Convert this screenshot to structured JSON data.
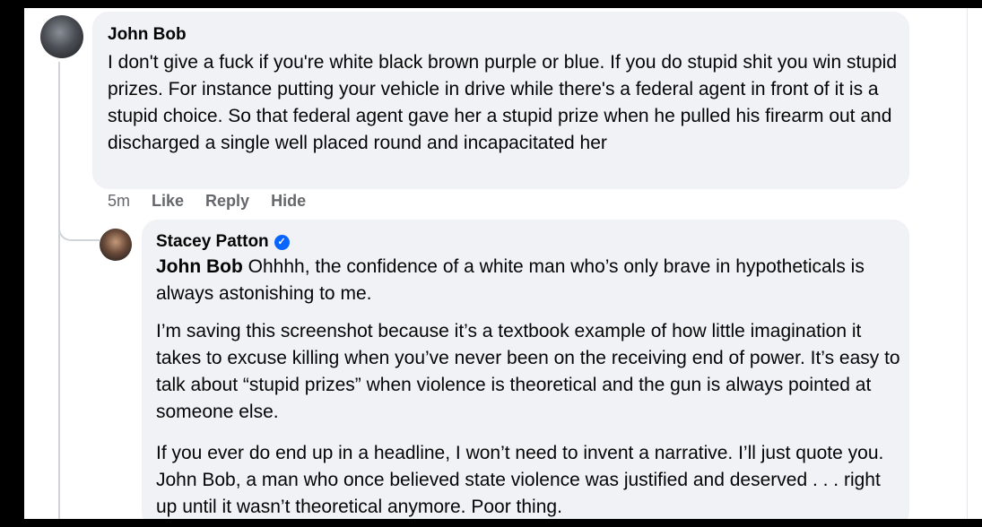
{
  "comments": [
    {
      "author": "John Bob",
      "text": "I don't give a fuck if you're white black brown purple or blue. If you do stupid shit you win stupid prizes. For instance putting your vehicle in drive while there's a federal agent in front of it is a stupid choice. So that federal agent gave her a stupid prize when he pulled his firearm out and discharged a single well placed round and incapacitated her",
      "time": "5m",
      "actions": [
        "Like",
        "Reply",
        "Hide"
      ]
    }
  ],
  "reply": {
    "author": "Stacey Patton",
    "verified": true,
    "mention": "John Bob",
    "paragraph1_rest": " Ohhhh, the confidence of a white man who’s only brave in hypotheticals is always astonishing to me.",
    "paragraph2": "I’m saving this screenshot because it’s a textbook example of how little imagination it takes to excuse killing when you’ve never been on the receiving end of power. It’s easy to talk about “stupid prizes” when violence is theoretical and the gun is always pointed at someone else.",
    "paragraph3": "If you ever do end up in a headline, I won’t need to invent a narrative. I’ll just quote you. John Bob, a man who once believed state violence was justified and deserved . . . right up until it wasn’t theoretical anymore. Poor thing."
  },
  "colors": {
    "bubble": "#f0f2f5",
    "text": "#050505",
    "meta": "#65676b",
    "verified": "#0866ff"
  },
  "icons": {
    "verified": "verified-badge-icon"
  }
}
